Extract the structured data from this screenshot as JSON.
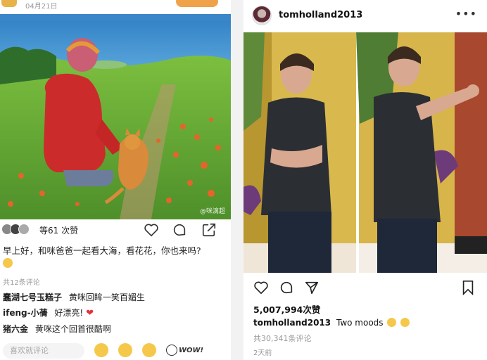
{
  "left_post": {
    "date": "04月21日",
    "watermark": "@咪滴超",
    "likes_text": "等61 次赞",
    "caption": "早上好，和咪爸爸一起看大海，看花花，你也来吗?",
    "comment_count": "共12条评论",
    "comments": [
      {
        "author": "蠢湖七号玉糕子",
        "text": "黄咪回眸一笑百媚生"
      },
      {
        "author": "ifeng-小蒨",
        "text": "好漂亮!"
      },
      {
        "author": "猪六金",
        "text": "黄咪这个回首很酷啊"
      }
    ],
    "input_placeholder": "喜欢就评论",
    "wow_label": "WOW!"
  },
  "right_post": {
    "username": "tomholland2013",
    "more_label": "•••",
    "likes_text": "5,007,994次赞",
    "caption_author": "tomholland2013",
    "caption_text": "Two moods",
    "comments_text": "共30,341条评论",
    "time_text": "2天前"
  },
  "colors": {
    "follow_button": "#f0a24a",
    "heart_red": "#e0333b",
    "emoji_yellow": "#f5c84b"
  },
  "icons": {
    "left_actions": [
      "heart-icon",
      "comment-icon",
      "share-icon"
    ],
    "right_actions": [
      "heart-icon",
      "comment-icon",
      "send-icon",
      "bookmark-icon"
    ]
  }
}
